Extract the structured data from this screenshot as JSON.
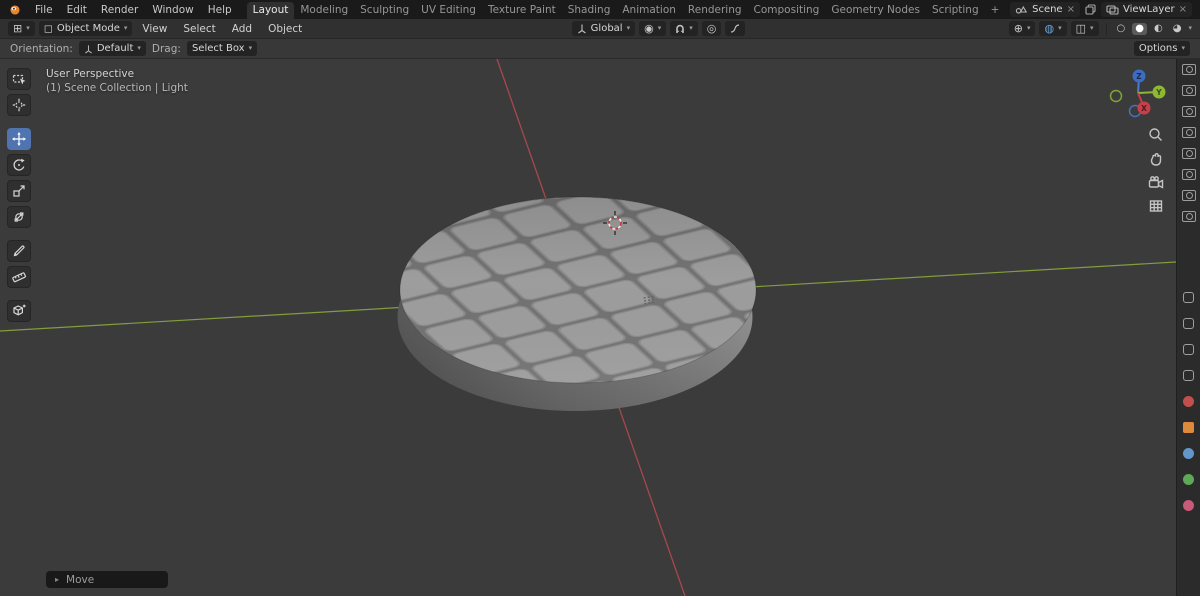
{
  "topbar": {
    "menus": [
      "File",
      "Edit",
      "Render",
      "Window",
      "Help"
    ],
    "workspaces": [
      {
        "label": "Layout",
        "active": true
      },
      {
        "label": "Modeling",
        "active": false
      },
      {
        "label": "Sculpting",
        "active": false
      },
      {
        "label": "UV Editing",
        "active": false
      },
      {
        "label": "Texture Paint",
        "active": false
      },
      {
        "label": "Shading",
        "active": false
      },
      {
        "label": "Animation",
        "active": false
      },
      {
        "label": "Rendering",
        "active": false
      },
      {
        "label": "Compositing",
        "active": false
      },
      {
        "label": "Geometry Nodes",
        "active": false
      },
      {
        "label": "Scripting",
        "active": false
      }
    ],
    "add_workspace_label": "+",
    "scene_selector": {
      "value": "Scene"
    },
    "view_layer_selector": {
      "value": "ViewLayer"
    }
  },
  "tool_header": {
    "editor_mode": "Object Mode",
    "menus": [
      "View",
      "Select",
      "Add",
      "Object"
    ],
    "transform_orientation": "Global"
  },
  "sub_header": {
    "orientation_label": "Orientation:",
    "orientation_value": "Default",
    "drag_label": "Drag:",
    "drag_value": "Select Box",
    "options_label": "Options"
  },
  "toolbar": {
    "tools": [
      {
        "name": "select-box",
        "active": false
      },
      {
        "name": "cursor",
        "active": false
      },
      {
        "name": "move",
        "active": true
      },
      {
        "name": "rotate",
        "active": false
      },
      {
        "name": "scale",
        "active": false
      },
      {
        "name": "transform",
        "active": false
      },
      {
        "name": "annotate",
        "active": false
      },
      {
        "name": "measure",
        "active": false
      },
      {
        "name": "add-cube",
        "active": false
      }
    ]
  },
  "viewport": {
    "view_label": "User Perspective",
    "collection_label": "(1) Scene Collection | Light",
    "operator_label": "Move",
    "gizmo_axes": {
      "x": "X",
      "y": "Y",
      "z": "Z"
    }
  },
  "right_strip": {
    "top_icons": [
      "camera",
      "camera",
      "camera",
      "camera",
      "camera",
      "camera",
      "camera",
      "camera"
    ],
    "properties_tabs": [
      {
        "name": "render",
        "color": "#9f9f9f"
      },
      {
        "name": "output",
        "color": "#9f9f9f"
      },
      {
        "name": "view-layer",
        "color": "#9f9f9f"
      },
      {
        "name": "scene",
        "color": "#9f9f9f"
      },
      {
        "name": "world",
        "color": "#c0504d"
      },
      {
        "name": "object",
        "color": "#dd8a3c"
      },
      {
        "name": "modifiers",
        "color": "#6496c8"
      },
      {
        "name": "data",
        "color": "#5fa858"
      },
      {
        "name": "material",
        "color": "#c75b78"
      }
    ]
  },
  "colors": {
    "accent_blue": "#4f74b0",
    "axis_x": "#bb4a52",
    "axis_y": "#8aa83e",
    "viewport_bg": "#3b3b3b",
    "object_gray": "#9c9c9c"
  }
}
